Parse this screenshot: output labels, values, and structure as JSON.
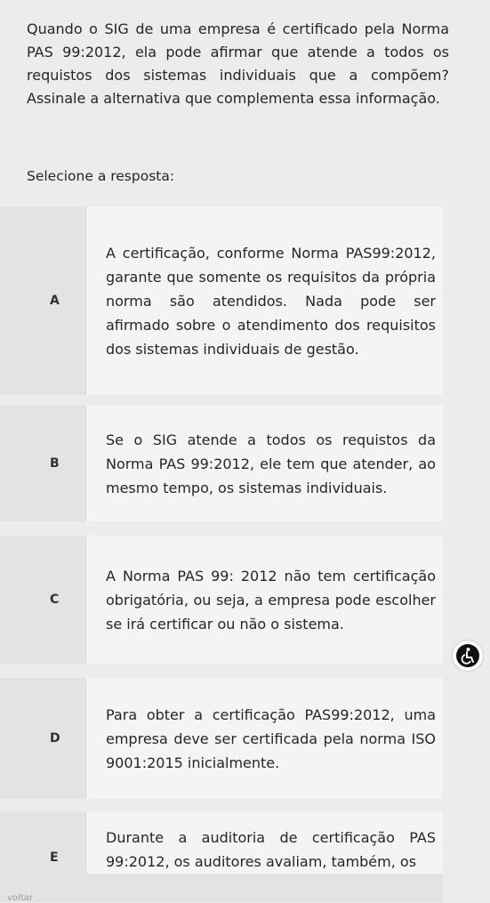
{
  "question": {
    "text": "Quando o SIG de uma empresa é certificado pela Norma PAS 99:2012, ela pode afirmar que atende a todos os requistos dos sistemas individuais que a compõem? Assinale a alternativa que complementa essa informação."
  },
  "prompt": "Selecione a resposta:",
  "options": [
    {
      "letter": "A",
      "text": "A certificação, conforme Norma PAS99:2012, garante que somente os requisitos da própria norma são atendidos. Nada pode ser afirmado sobre o atendimento dos requisitos dos sistemas individuais de gestão."
    },
    {
      "letter": "B",
      "text": "Se o SIG atende a todos os requistos da Norma PAS 99:2012, ele tem que atender, ao mesmo tempo, os sistemas individuais."
    },
    {
      "letter": "C",
      "text": "A Norma PAS 99: 2012 não tem certificação obrigatória, ou seja, a empresa pode escolher se irá certificar ou não o sistema."
    },
    {
      "letter": "D",
      "text": "Para obter a certificação PAS99:2012, uma empresa deve ser certificada pela norma ISO 9001:2015 inicialmente."
    },
    {
      "letter": "E",
      "text": "Durante a auditoria de certificação PAS 99:2012, os auditores avaliam, também, os"
    }
  ],
  "footer": {
    "back_link": "voltar"
  },
  "icons": {
    "accessibility": "accessibility-icon"
  }
}
